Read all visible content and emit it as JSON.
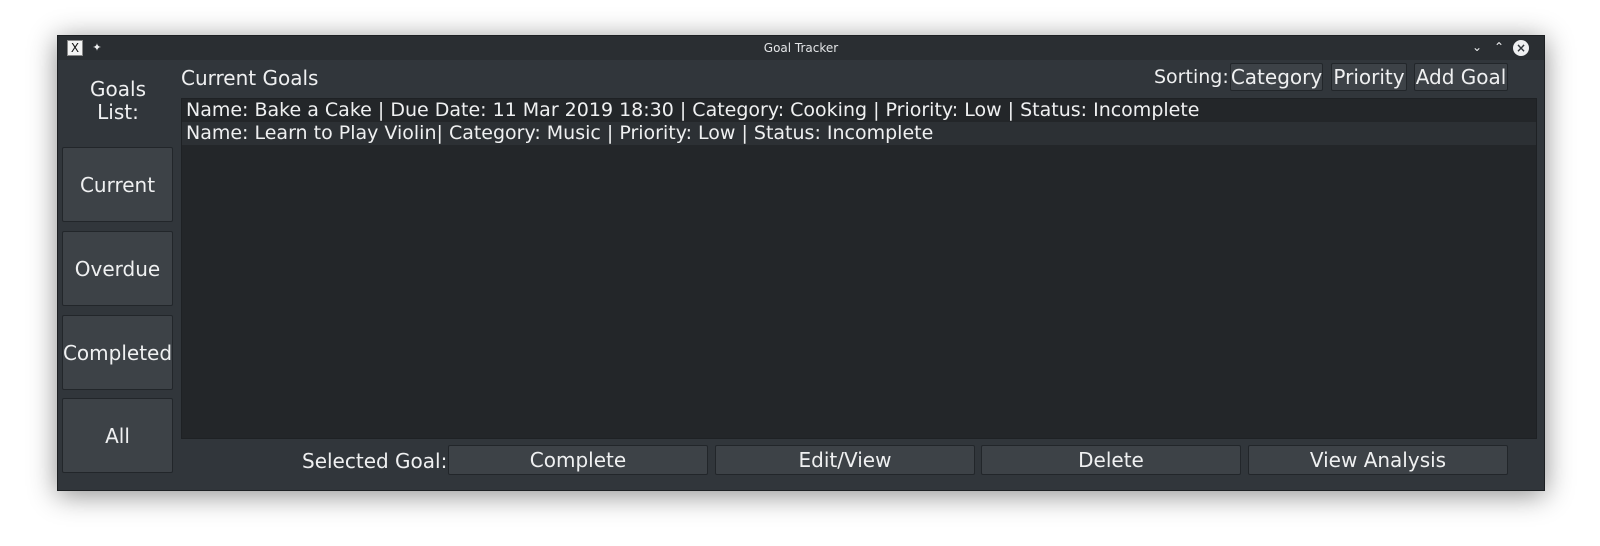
{
  "window": {
    "title": "Goal Tracker"
  },
  "titlebar_icons": {
    "app": "x-app-icon",
    "pin": "pin-icon",
    "minimize": "chevron-down-icon",
    "maximize": "chevron-up-icon",
    "close": "close-icon"
  },
  "sidebar": {
    "title": "Goals List:",
    "items": [
      {
        "label": "Current"
      },
      {
        "label": "Overdue"
      },
      {
        "label": "Completed"
      },
      {
        "label": "All"
      }
    ]
  },
  "main": {
    "heading": "Current Goals",
    "sorting_label": "Sorting:",
    "buttons": {
      "category": "Category",
      "priority": "Priority",
      "add_goal": "Add Goal"
    },
    "goals": [
      "Name: Bake a Cake | Due Date: 11 Mar 2019 18:30 | Category: Cooking | Priority: Low | Status: Incomplete",
      "Name: Learn to Play Violin| Category: Music | Priority: Low | Status: Incomplete"
    ]
  },
  "footer": {
    "selected_label": "Selected Goal:",
    "complete": "Complete",
    "edit_view": "Edit/View",
    "delete": "Delete",
    "view_analysis": "View Analysis"
  },
  "colors": {
    "window_bg": "#31363b",
    "list_bg": "#232629",
    "button_bg": "#3d4247",
    "text": "#eff0f1"
  }
}
